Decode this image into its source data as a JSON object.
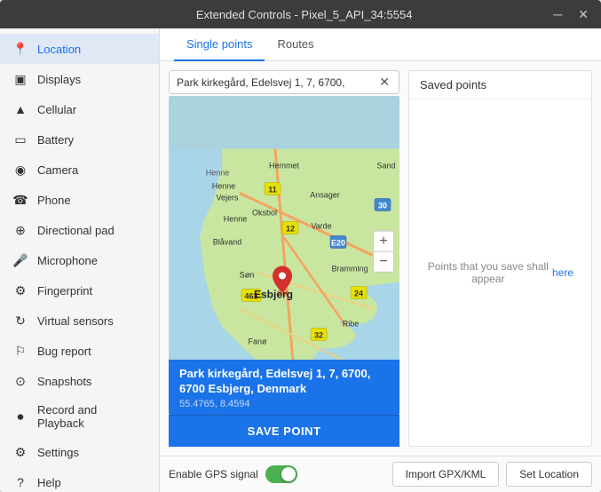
{
  "window": {
    "title": "Extended Controls - Pixel_5_API_34:5554",
    "minimize_label": "─",
    "close_label": "✕"
  },
  "sidebar": {
    "items": [
      {
        "id": "location",
        "label": "Location",
        "icon": "📍",
        "active": true
      },
      {
        "id": "displays",
        "label": "Displays",
        "icon": "🖥"
      },
      {
        "id": "cellular",
        "label": "Cellular",
        "icon": "📶"
      },
      {
        "id": "battery",
        "label": "Battery",
        "icon": "🔋"
      },
      {
        "id": "camera",
        "label": "Camera",
        "icon": "📷"
      },
      {
        "id": "phone",
        "label": "Phone",
        "icon": "📞"
      },
      {
        "id": "directional-pad",
        "label": "Directional pad",
        "icon": "🕹"
      },
      {
        "id": "microphone",
        "label": "Microphone",
        "icon": "🎤"
      },
      {
        "id": "fingerprint",
        "label": "Fingerprint",
        "icon": "⚙"
      },
      {
        "id": "virtual-sensors",
        "label": "Virtual sensors",
        "icon": "🔄"
      },
      {
        "id": "bug-report",
        "label": "Bug report",
        "icon": "🐛"
      },
      {
        "id": "snapshots",
        "label": "Snapshots",
        "icon": "📷"
      },
      {
        "id": "record-playback",
        "label": "Record and Playback",
        "icon": "⏺"
      },
      {
        "id": "settings",
        "label": "Settings",
        "icon": "⚙"
      },
      {
        "id": "help",
        "label": "Help",
        "icon": "❓"
      }
    ]
  },
  "tabs": [
    {
      "id": "single-points",
      "label": "Single points",
      "active": true
    },
    {
      "id": "routes",
      "label": "Routes",
      "active": false
    }
  ],
  "map": {
    "search_text": "Park kirkegård, Edelsvej 1, 7, 6700,",
    "location_name": "Park kirkegård, Edelsvej 1, 7, 6700, 6700 Esbjerg, Denmark",
    "coordinates": "55.4765, 8.4594",
    "zoom_plus": "+",
    "zoom_minus": "−"
  },
  "saved_points": {
    "title": "Saved points",
    "empty_text": "Points that you save shall appear",
    "empty_link": "here"
  },
  "bottom": {
    "gps_label": "Enable GPS signal",
    "import_btn": "Import GPX/KML",
    "set_location_btn": "Set Location",
    "save_point_btn": "SAVE POINT"
  }
}
